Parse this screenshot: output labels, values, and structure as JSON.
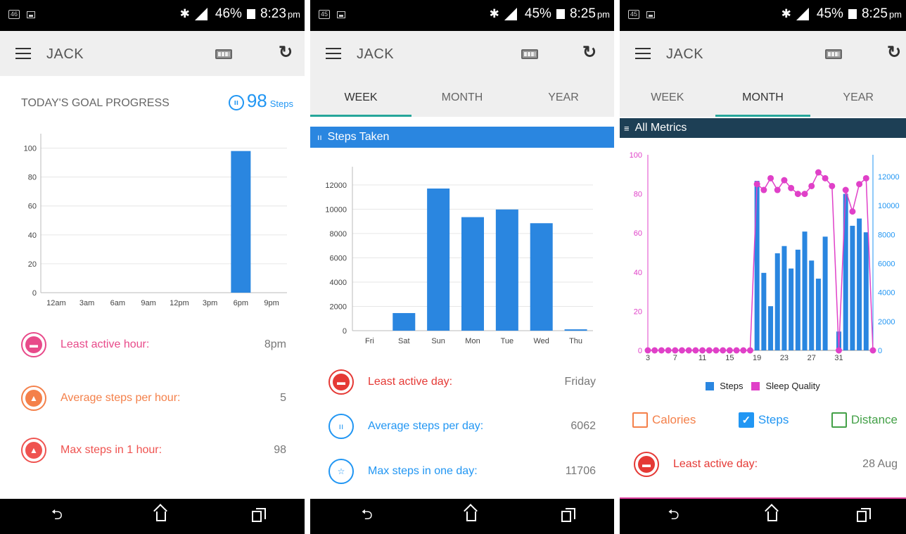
{
  "status": {
    "left_badge_1": "46",
    "left_badge_2": "45",
    "left_badge_3": "45",
    "screen1": {
      "battery": "46%",
      "time": "8:23",
      "ampm": "pm"
    },
    "screen2": {
      "battery": "45%",
      "time": "8:25",
      "ampm": "pm"
    },
    "screen3": {
      "battery": "45%",
      "time": "8:25",
      "ampm": "pm"
    }
  },
  "app": {
    "title": "JACK"
  },
  "tabs": [
    "WEEK",
    "MONTH",
    "YEAR"
  ],
  "screen1": {
    "goal_label": "TODAY'S GOAL PROGRESS",
    "goal_value": "98",
    "goal_unit": "Steps",
    "stats": [
      {
        "label": "Least active hour:",
        "value": "8pm",
        "color": "#e84a8a"
      },
      {
        "label": "Average steps per hour:",
        "value": "5",
        "color": "#f4804a"
      },
      {
        "label": "Max steps in 1 hour:",
        "value": "98",
        "color": "#ef5350"
      }
    ]
  },
  "screen2": {
    "section": "Steps Taken",
    "stats": [
      {
        "label": "Least active day:",
        "value": "Friday",
        "color": "#e53935"
      },
      {
        "label": "Average steps per day:",
        "value": "6062",
        "color": "#2196f3"
      },
      {
        "label": "Max steps in one day:",
        "value": "11706",
        "color": "#2196f3"
      }
    ]
  },
  "screen3": {
    "section": "All Metrics",
    "legend": [
      "Steps",
      "Sleep Quality"
    ],
    "checks": [
      {
        "label": "Calories",
        "checked": false,
        "color": "#f4804a"
      },
      {
        "label": "Steps",
        "checked": true,
        "color": "#2196f3"
      },
      {
        "label": "Distance",
        "checked": false,
        "color": "#43a047"
      }
    ],
    "stat": {
      "label": "Least active day:",
      "value": "28 Aug",
      "color": "#e53935"
    }
  },
  "colors": {
    "accent": "#2196f3",
    "tab_indicator": "#26a69a",
    "dark_header": "#1d3f55",
    "sleep": "#e040c8"
  },
  "chart_data": [
    {
      "type": "bar",
      "categories": [
        "12am",
        "3am",
        "6am",
        "9am",
        "12pm",
        "3pm",
        "6pm",
        "9pm"
      ],
      "values": [
        0,
        0,
        0,
        0,
        0,
        0,
        98,
        0
      ],
      "yticks": [
        0,
        20,
        40,
        60,
        80,
        100
      ],
      "ylim": [
        0,
        110
      ]
    },
    {
      "type": "bar",
      "categories": [
        "Fri",
        "Sat",
        "Sun",
        "Mon",
        "Tue",
        "Wed",
        "Thu"
      ],
      "values": [
        0,
        1450,
        11706,
        9350,
        9980,
        8850,
        110
      ],
      "yticks": [
        0,
        2000,
        4000,
        6000,
        8000,
        10000,
        12000
      ],
      "ylim": [
        0,
        13500
      ]
    },
    {
      "type": "bar+line",
      "xticks": [
        "3",
        "7",
        "11",
        "15",
        "19",
        "23",
        "27",
        "31"
      ],
      "x_start": 3,
      "series": [
        {
          "name": "Steps",
          "axis": "right",
          "values": [
            0,
            0,
            0,
            0,
            0,
            0,
            0,
            0,
            0,
            0,
            0,
            0,
            0,
            0,
            0,
            0,
            11700,
            5350,
            3050,
            6700,
            7200,
            5650,
            6950,
            8200,
            6200,
            4950,
            7850,
            0,
            1300,
            10800,
            8600,
            9100,
            8150
          ]
        },
        {
          "name": "Sleep Quality",
          "axis": "left",
          "values": [
            0,
            0,
            0,
            0,
            0,
            0,
            0,
            0,
            0,
            0,
            0,
            0,
            0,
            0,
            0,
            0,
            85,
            82,
            88,
            82,
            87,
            83,
            80,
            80,
            84,
            91,
            88,
            84,
            0,
            82,
            71,
            85,
            88,
            0
          ]
        }
      ],
      "yleft_ticks": [
        0,
        20,
        40,
        60,
        80,
        100
      ],
      "yright_ticks": [
        0,
        2000,
        4000,
        6000,
        8000,
        10000,
        12000
      ]
    }
  ]
}
